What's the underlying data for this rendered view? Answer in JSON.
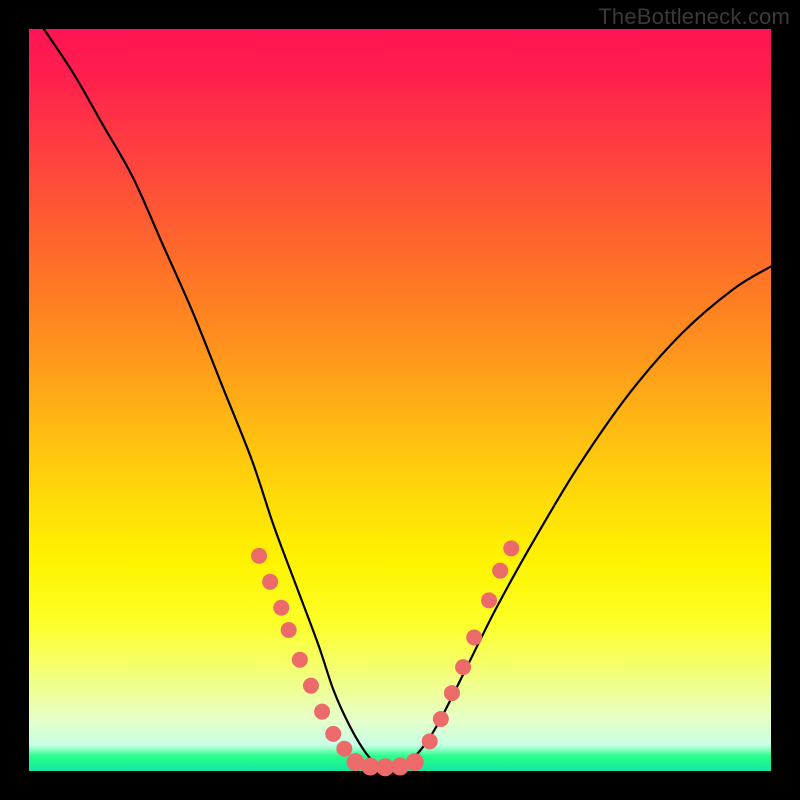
{
  "watermark": "TheBottleneck.com",
  "colors": {
    "frame": "#000000",
    "curve": "#000000",
    "dot": "#ec6a6a"
  },
  "chart_data": {
    "type": "line",
    "title": "",
    "xlabel": "",
    "ylabel": "",
    "ylim": [
      0,
      100
    ],
    "xlim": [
      0,
      100
    ],
    "note": "Two bottleneck curves (left-falling, right-rising) with salmon data markers near valley. Values read from pixel positions; y normalized 0 (bottom) to 100 (top).",
    "series": [
      {
        "name": "curve-left",
        "x": [
          2,
          6,
          10,
          14,
          18,
          22,
          26,
          30,
          33,
          36,
          39,
          41,
          43,
          45,
          46.5,
          48
        ],
        "y": [
          100,
          94,
          87,
          80,
          71,
          62,
          52,
          42,
          33,
          25,
          17,
          11,
          6.5,
          3,
          1.2,
          0.5
        ]
      },
      {
        "name": "curve-right",
        "x": [
          48,
          50,
          52,
          54,
          56,
          59,
          63,
          68,
          74,
          81,
          88,
          95,
          100
        ],
        "y": [
          0.5,
          0.8,
          2,
          4.5,
          8,
          14,
          22,
          31,
          41,
          51,
          59,
          65,
          68
        ]
      }
    ],
    "markers_left": [
      {
        "x": 31,
        "y": 29
      },
      {
        "x": 32.5,
        "y": 25.5
      },
      {
        "x": 34,
        "y": 22
      },
      {
        "x": 35,
        "y": 19
      },
      {
        "x": 36.5,
        "y": 15
      },
      {
        "x": 38,
        "y": 11.5
      },
      {
        "x": 39.5,
        "y": 8
      },
      {
        "x": 41,
        "y": 5
      },
      {
        "x": 42.5,
        "y": 3
      }
    ],
    "markers_bottom": [
      {
        "x": 44,
        "y": 1.2
      },
      {
        "x": 46,
        "y": 0.6
      },
      {
        "x": 48,
        "y": 0.5
      },
      {
        "x": 50,
        "y": 0.6
      },
      {
        "x": 52,
        "y": 1.2
      }
    ],
    "markers_right": [
      {
        "x": 54,
        "y": 4
      },
      {
        "x": 55.5,
        "y": 7
      },
      {
        "x": 57,
        "y": 10.5
      },
      {
        "x": 58.5,
        "y": 14
      },
      {
        "x": 60,
        "y": 18
      },
      {
        "x": 62,
        "y": 23
      },
      {
        "x": 63.5,
        "y": 27
      },
      {
        "x": 65,
        "y": 30
      }
    ]
  }
}
